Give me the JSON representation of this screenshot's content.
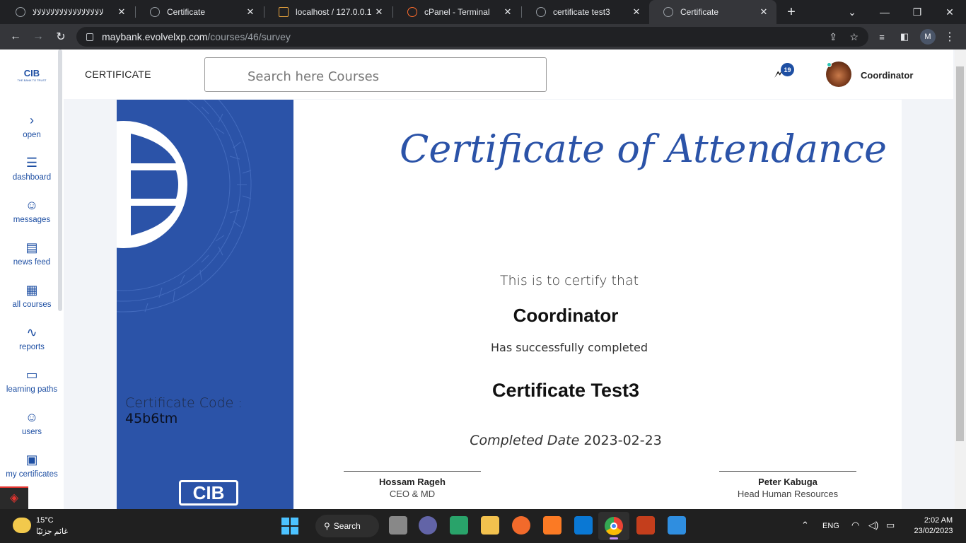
{
  "browser": {
    "tabs": [
      {
        "title": "ﻻﻻﻻﻻﻻﻻﻻﻻﻻﻻﻻﻻﻻﻻﻻﻻ"
      },
      {
        "title": "Certificate"
      },
      {
        "title": "localhost / 127.0.0.1 /"
      },
      {
        "title": "cPanel - Terminal"
      },
      {
        "title": "certificate test3"
      },
      {
        "title": "Certificate"
      }
    ],
    "new_tab": "+",
    "url_host": "maybank.evolvelxp.com",
    "url_path": "/courses/46/survey",
    "profile_initial": "M"
  },
  "sidebar": {
    "logo_text": "CIB",
    "logo_tagline": "THE BANK TO TRUST",
    "items": [
      {
        "label": "open",
        "icon": "chevron-right-icon"
      },
      {
        "label": "dashboard",
        "icon": "list-icon"
      },
      {
        "label": "messages",
        "icon": "chat-icon"
      },
      {
        "label": "news feed",
        "icon": "news-icon"
      },
      {
        "label": "all courses",
        "icon": "grid-icon"
      },
      {
        "label": "reports",
        "icon": "pulse-icon"
      },
      {
        "label": "learning paths",
        "icon": "monitor-icon"
      },
      {
        "label": "users",
        "icon": "user-icon"
      },
      {
        "label": "my certificates",
        "icon": "certificate-icon"
      }
    ]
  },
  "header": {
    "title": "CERTIFICATE",
    "search_placeholder": "Search here Courses",
    "notification_count": "19",
    "user_name": "Coordinator"
  },
  "certificate": {
    "title": "Certificate of Attendance",
    "intro": "This is to certify that",
    "recipient": "Coordinator",
    "completed_text": "Has successfully completed",
    "course": "Certificate Test3",
    "date_label": "Completed Date",
    "date_value": "2023-02-23",
    "code_label": "Certificate Code :",
    "code_value": "45b6tm",
    "logo_text": "CIB",
    "signatures": [
      {
        "name": "Hossam Rageh",
        "role": "CEO & MD"
      },
      {
        "name": "Peter Kabuga",
        "role": "Head  Human Resources"
      }
    ],
    "band_color": "#2b53a8"
  },
  "taskbar": {
    "weather_temp": "15°C",
    "weather_text": "غائم جزئيًا",
    "search_label": "Search",
    "language": "ENG",
    "time": "2:02 AM",
    "date": "23/02/2023"
  }
}
